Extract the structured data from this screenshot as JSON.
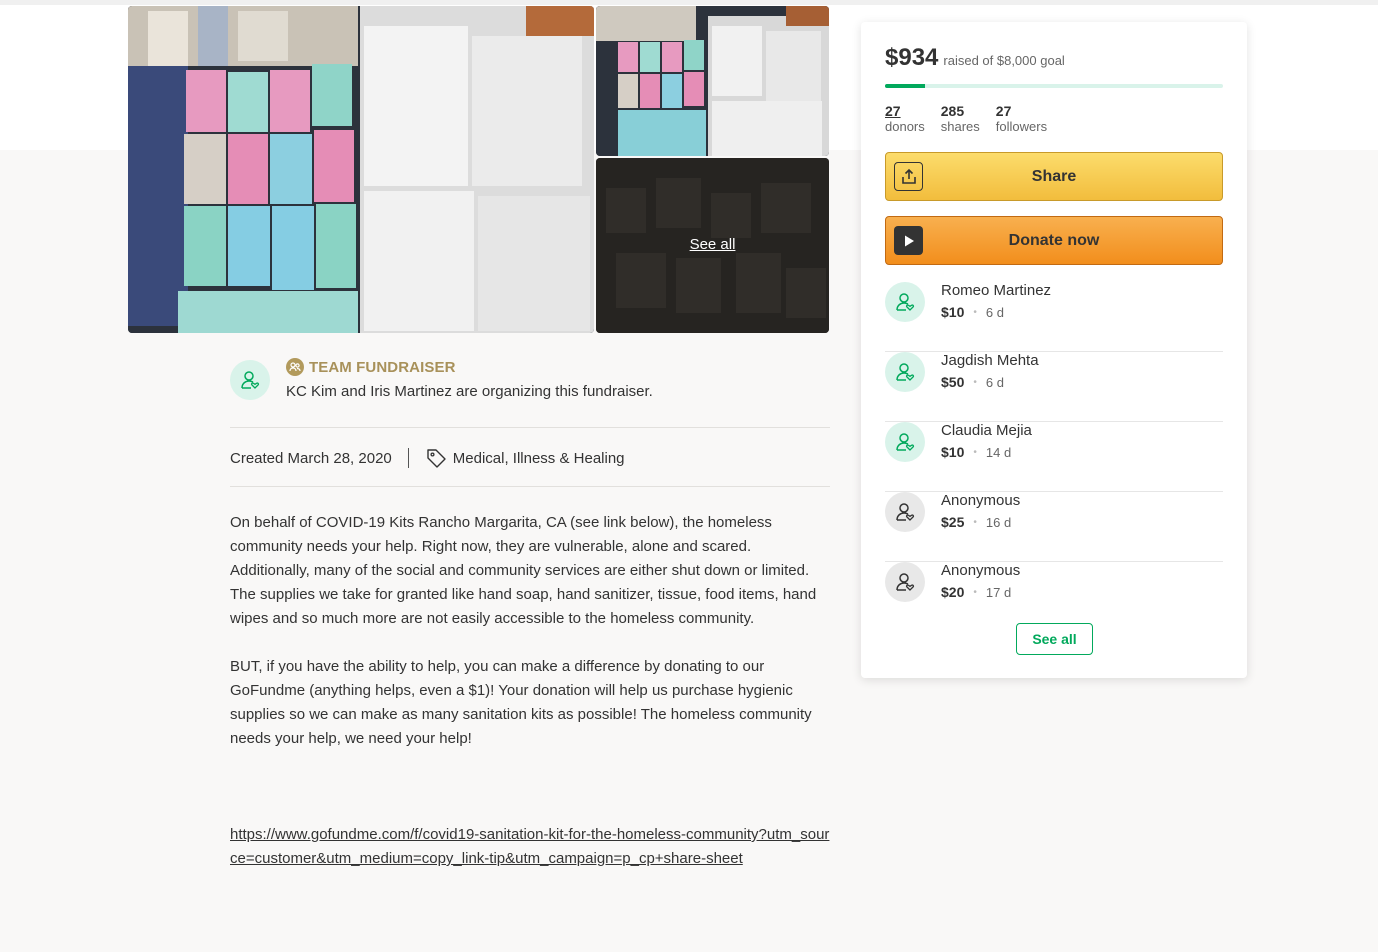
{
  "gallery": {
    "see_all_label": "See all"
  },
  "organizer": {
    "team_label": "TEAM FUNDRAISER",
    "text": "KC Kim and Iris Martinez are organizing this fundraiser."
  },
  "meta": {
    "created": "Created March 28, 2020",
    "category": "Medical, Illness & Healing"
  },
  "story": {
    "paragraphs": [
      "On behalf of COVID-19 Kits Rancho Margarita, CA (see link below), the homeless community needs your help.  Right now, they are vulnerable, alone and scared. Additionally, many of the social and community services are either shut down or limited. The supplies we take for granted like hand soap, hand sanitizer, tissue, food items, hand wipes and so much more are not easily accessible to the homeless community.",
      "BUT, if you have the ability to help, you can make a difference by donating to our GoFundme (anything helps, even a $1)! Your donation will help us purchase hygienic supplies so we can make as many sanitation kits as possible! The homeless community needs your help, we need your help!"
    ],
    "link": "https://www.gofundme.com/f/covid19-sanitation-kit-for-the-homeless-community?utm_source=customer&utm_medium=copy_link-tip&utm_campaign=p_cp+share-sheet"
  },
  "sidebar": {
    "amount": "$934",
    "goal_text": "raised of $8,000 goal",
    "progress": 0.117,
    "colors": {
      "accent": "#02a95c",
      "share": "#f2bd3d",
      "donate": "#f28e1c"
    },
    "stats": [
      {
        "num": "27",
        "label": "donors"
      },
      {
        "num": "285",
        "label": "shares"
      },
      {
        "num": "27",
        "label": "followers"
      }
    ],
    "share_label": "Share",
    "donate_label": "Donate now",
    "donations": [
      {
        "name": "Romeo Martinez",
        "amount": "$10",
        "time": "6 d",
        "avatar": "green"
      },
      {
        "name": "Jagdish Mehta",
        "amount": "$50",
        "time": "6 d",
        "avatar": "green"
      },
      {
        "name": "Claudia Mejia",
        "amount": "$10",
        "time": "14 d",
        "avatar": "green"
      },
      {
        "name": "Anonymous",
        "amount": "$25",
        "time": "16 d",
        "avatar": "grey"
      },
      {
        "name": "Anonymous",
        "amount": "$20",
        "time": "17 d",
        "avatar": "grey"
      }
    ],
    "see_all_label": "See all"
  }
}
